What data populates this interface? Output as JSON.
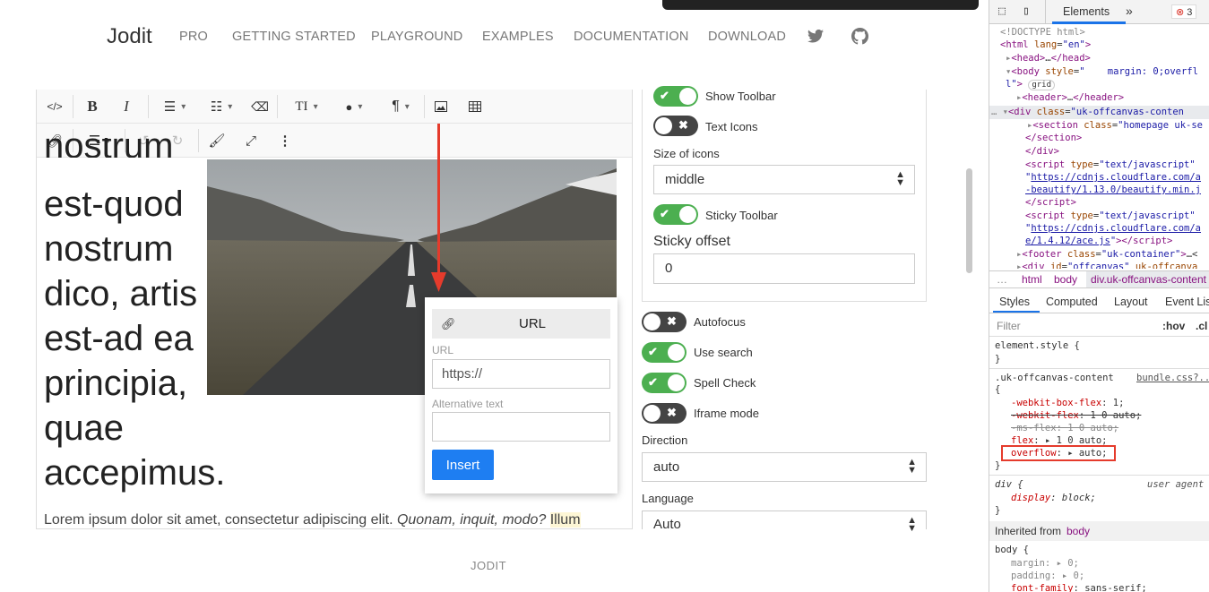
{
  "nav": {
    "brand": "Jodit",
    "links": [
      "PRO",
      "GETTING STARTED",
      "PLAYGROUND",
      "EXAMPLES",
      "DOCUMENTATION",
      "DOWNLOAD"
    ]
  },
  "editor": {
    "text_lines": [
      "nostrum",
      "est-quod",
      "nostrum",
      "dico, artis",
      "est-ad ea",
      "principia,",
      "quae",
      "accepimus."
    ],
    "lorem": "Lorem ipsum dolor sit amet, consectetur adipiscing elit. ",
    "lorem_italic": "Quonam, inquit, modo?",
    "lorem_hl": "Illum"
  },
  "popup": {
    "tab": "URL",
    "url_label": "URL",
    "url_value": "https://",
    "alt_label": "Alternative text",
    "alt_value": "",
    "insert": "Insert"
  },
  "options": {
    "show_toolbar": "Show Toolbar",
    "text_icons": "Text Icons",
    "size_of_icons": "Size of icons",
    "size_value": "middle",
    "sticky_toolbar": "Sticky Toolbar",
    "sticky_offset": "Sticky offset",
    "sticky_value": "0",
    "autofocus": "Autofocus",
    "use_search": "Use search",
    "spell_check": "Spell Check",
    "iframe_mode": "Iframe mode",
    "direction": "Direction",
    "direction_value": "auto",
    "language": "Language",
    "language_value": "Auto"
  },
  "devtools": {
    "tab_elements": "Elements",
    "more": "»",
    "errors": "3",
    "crumbs": [
      "html",
      "body",
      "div.uk-offcanvas-content"
    ],
    "tabs": [
      "Styles",
      "Computed",
      "Layout",
      "Event Lis"
    ],
    "filter": "Filter",
    "hov": ":hov",
    ".cls": ".cl",
    "element_style": "element.style {",
    "close": "}",
    "rule_selector": ".uk-offcanvas-content",
    "rule_source": "bundle.css?...",
    "div_rule": "div {",
    "user_agent": "user agent",
    "inherited": "Inherited from",
    "inherited_el": "body"
  },
  "footer": "JODIT",
  "colors": {
    "accent": "#1e7ef2",
    "toggle_on": "#4caf50",
    "highlight": "#e53b2c"
  }
}
